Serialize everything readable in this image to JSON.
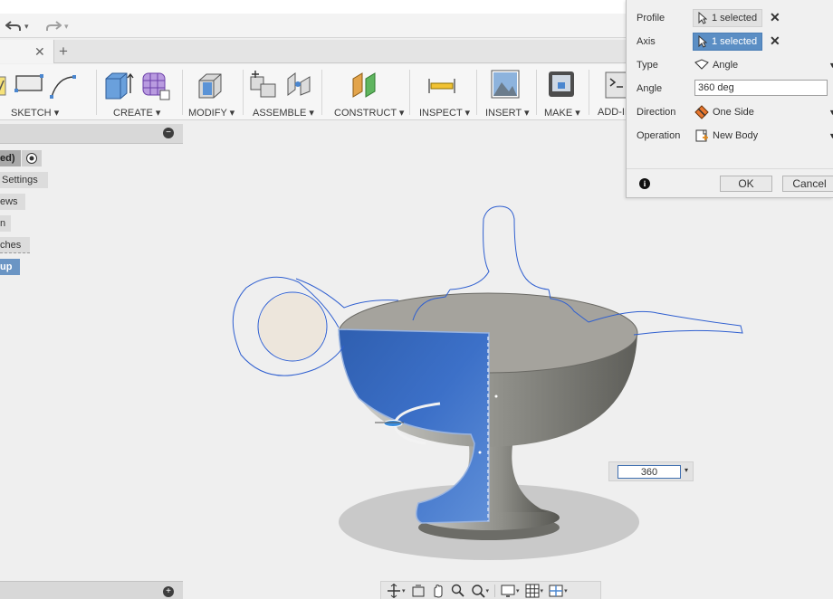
{
  "toolbar": {
    "groups": [
      {
        "label": "SKETCH"
      },
      {
        "label": "CREATE"
      },
      {
        "label": "MODIFY"
      },
      {
        "label": "ASSEMBLE"
      },
      {
        "label": "CONSTRUCT"
      },
      {
        "label": "INSPECT"
      },
      {
        "label": "INSERT"
      },
      {
        "label": "MAKE"
      },
      {
        "label": "ADD-IN"
      }
    ],
    "dropdown_glyph": "▾"
  },
  "tabs": {
    "close_glyph": "✕",
    "new_tab_glyph": "+"
  },
  "browser": {
    "rows": [
      {
        "label": "ed)"
      },
      {
        "label": "Settings"
      },
      {
        "label": "ews"
      },
      {
        "label": "n"
      },
      {
        "label": "ches"
      },
      {
        "label": "up"
      }
    ],
    "collapse_glyph": "−",
    "expand_glyph": "+"
  },
  "dialog": {
    "profile": {
      "label": "Profile",
      "value": "1 selected"
    },
    "axis": {
      "label": "Axis",
      "value": "1 selected"
    },
    "type": {
      "label": "Type",
      "value": "Angle"
    },
    "angle": {
      "label": "Angle",
      "value": "360 deg"
    },
    "direction": {
      "label": "Direction",
      "value": "One Side"
    },
    "operation": {
      "label": "Operation",
      "value": "New Body"
    },
    "clear_glyph": "✕",
    "info_glyph": "i",
    "ok_label": "OK",
    "cancel_label": "Cancel"
  },
  "canvas": {
    "angle_value": "360",
    "dropdown_glyph": "▾"
  },
  "colors": {
    "selection_blue": "#3c6fc4",
    "sketch_line": "#2f5fd0",
    "body_gray": "#8b8b85",
    "active_field": "#5b8ec4"
  }
}
